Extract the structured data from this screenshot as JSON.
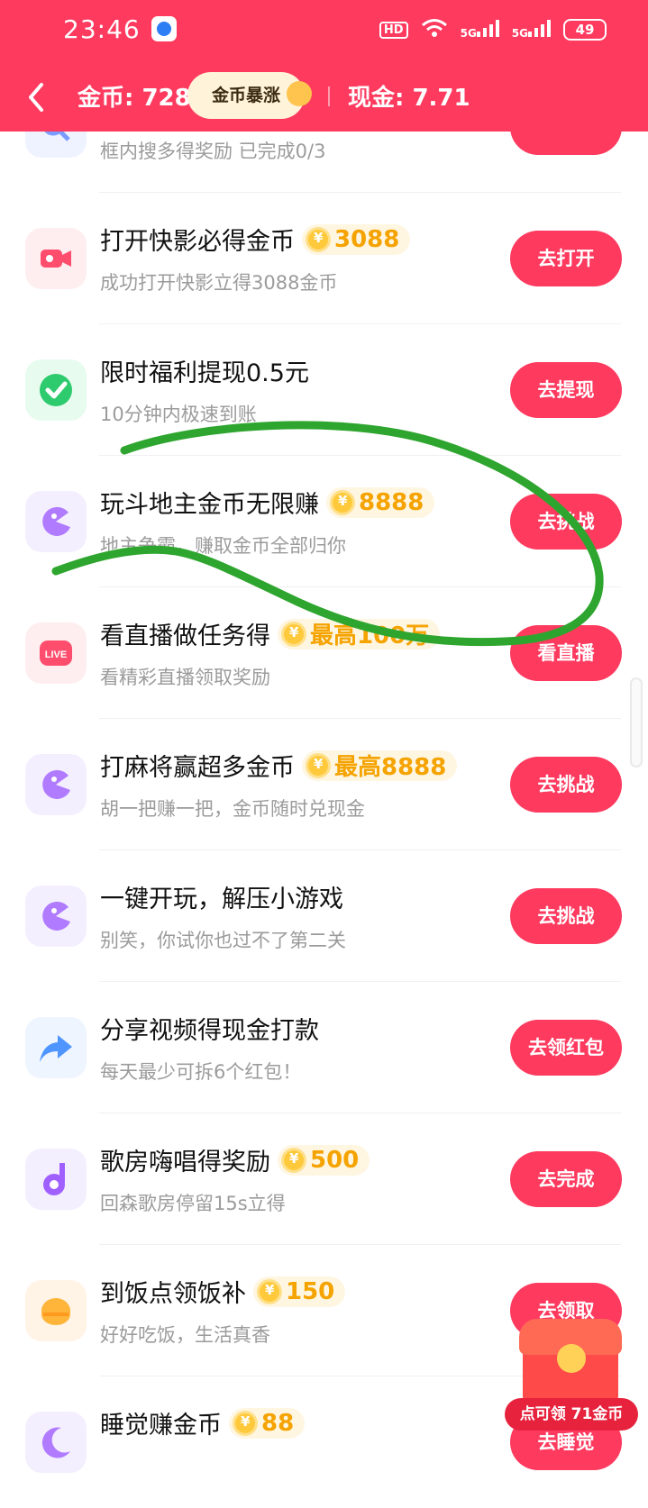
{
  "status_bar": {
    "time": "23:46",
    "hd": "HD",
    "net1": "5G",
    "net2": "5G",
    "battery": "49"
  },
  "header": {
    "coins_label": "金币: 728",
    "boost_label": "金币暴涨",
    "cash_label": "现金: 7.71"
  },
  "tasks": [
    {
      "title": "",
      "reward": "",
      "sub": "框内搜多得奖励 已完成0/3",
      "button": "",
      "icon": "search-icon",
      "icon_bg": "#eef3ff"
    },
    {
      "title": "打开快影必得金币",
      "reward": "3088",
      "sub": "成功打开快影立得3088金币",
      "button": "去打开",
      "icon": "video-camera-icon",
      "icon_bg": "#ffeef0"
    },
    {
      "title": "限时福利提现0.5元",
      "reward": "",
      "sub": "10分钟内极速到账",
      "button": "去提现",
      "icon": "wechat-pay-icon",
      "icon_bg": "#e7fbef"
    },
    {
      "title": "玩斗地主金币无限赚",
      "reward": "8888",
      "sub": "地主争霸，赚取金币全部归你",
      "button": "去挑战",
      "icon": "game-pacman-icon",
      "icon_bg": "#f4efff"
    },
    {
      "title": "看直播做任务得",
      "reward": "最高100万",
      "sub": "看精彩直播领取奖励",
      "button": "看直播",
      "icon": "live-icon",
      "icon_bg": "#ffeef0"
    },
    {
      "title": "打麻将赢超多金币",
      "reward": "最高8888",
      "sub": "胡一把赚一把，金币随时兑现金",
      "button": "去挑战",
      "icon": "game-pacman-icon",
      "icon_bg": "#f4efff"
    },
    {
      "title": "一键开玩，解压小游戏",
      "reward": "",
      "sub": "别笑，你试你也过不了第二关",
      "button": "去挑战",
      "icon": "game-pacman-icon",
      "icon_bg": "#f4efff"
    },
    {
      "title": "分享视频得现金打款",
      "reward": "",
      "sub": "每天最少可拆6个红包！",
      "button": "去领红包",
      "icon": "share-arrow-icon",
      "icon_bg": "#eef5ff"
    },
    {
      "title": "歌房嗨唱得奖励",
      "reward": "500",
      "sub": "回森歌房停留15s立得",
      "button": "去完成",
      "icon": "music-note-icon",
      "icon_bg": "#f4efff"
    },
    {
      "title": "到饭点领饭补",
      "reward": "150",
      "sub": "好好吃饭，生活真香",
      "button": "去领取",
      "icon": "meal-icon",
      "icon_bg": "#fff4e6"
    },
    {
      "title": "睡觉赚金币",
      "reward": "88",
      "sub": "",
      "button": "去睡觉",
      "icon": "moon-icon",
      "icon_bg": "#f4efff"
    }
  ],
  "floating": {
    "chest_label": "点可领 71金币"
  },
  "colors": {
    "brand": "#fe3a5f",
    "reward": "#f5a300",
    "scribble": "#2ea52e"
  }
}
